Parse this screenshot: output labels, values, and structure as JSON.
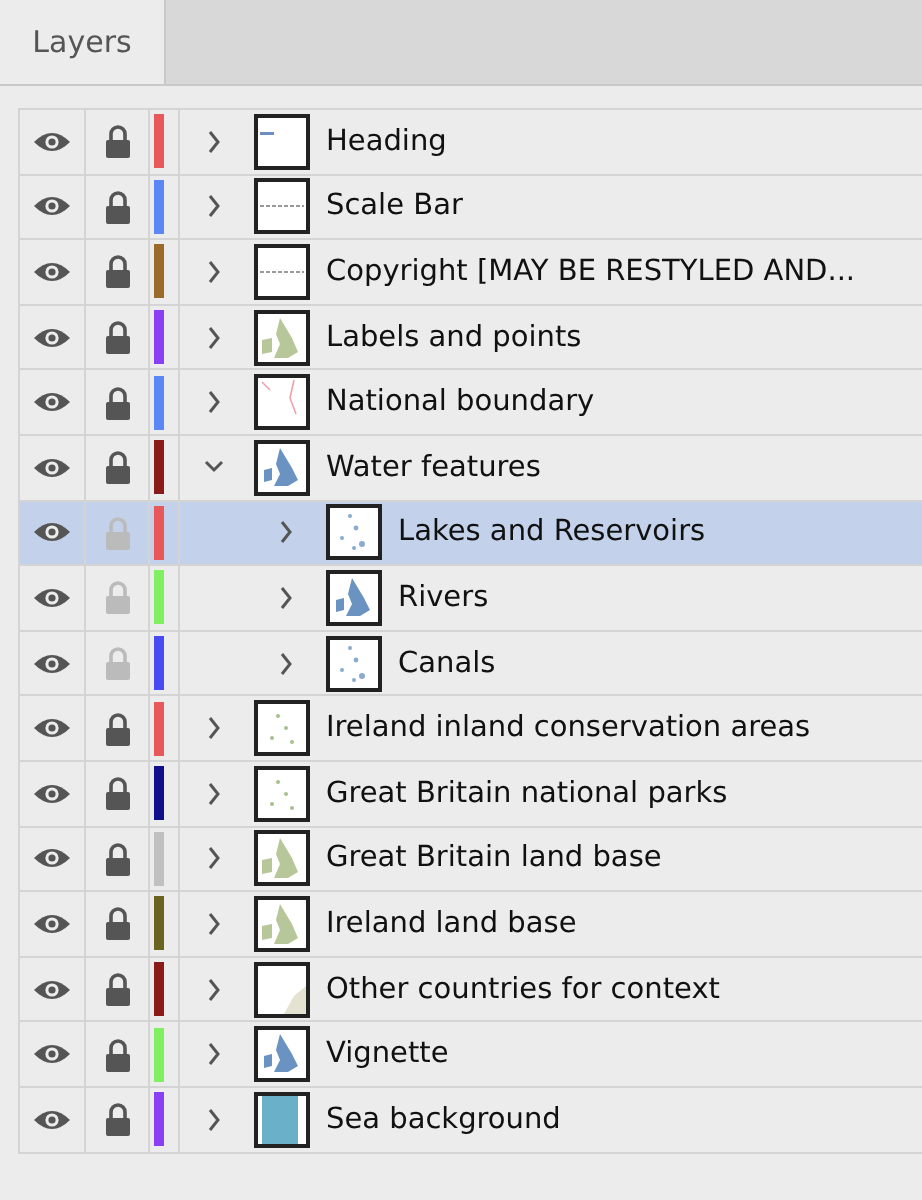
{
  "tab": {
    "label": "Layers",
    "selected": true
  },
  "layers": [
    {
      "name": "Heading",
      "color": "#e8585a",
      "visible": true,
      "locked": true,
      "expanded": false,
      "selected": false,
      "kind": "heading"
    },
    {
      "name": "Scale Bar",
      "color": "#5b86f5",
      "visible": true,
      "locked": true,
      "expanded": false,
      "selected": false,
      "kind": "scale"
    },
    {
      "name": "Copyright [MAY BE RESTYLED AND...",
      "color": "#9a6a2a",
      "visible": true,
      "locked": true,
      "expanded": false,
      "selected": false,
      "kind": "scale"
    },
    {
      "name": "Labels and points",
      "color": "#8a3ff5",
      "visible": true,
      "locked": true,
      "expanded": false,
      "selected": false,
      "kind": "land"
    },
    {
      "name": "National boundary",
      "color": "#5b86f5",
      "visible": true,
      "locked": true,
      "expanded": false,
      "selected": false,
      "kind": "lines"
    },
    {
      "name": "Water features",
      "color": "#8b1a1a",
      "visible": true,
      "locked": true,
      "expanded": true,
      "selected": false,
      "kind": "map",
      "children": [
        {
          "name": "Lakes and Reservoirs",
          "color": "#e8585a",
          "visible": true,
          "locked": false,
          "expanded": false,
          "selected": true,
          "kind": "speckle"
        },
        {
          "name": "Rivers",
          "color": "#80f060",
          "visible": true,
          "locked": false,
          "expanded": false,
          "selected": false,
          "kind": "map"
        },
        {
          "name": "Canals",
          "color": "#4a4af5",
          "visible": true,
          "locked": false,
          "expanded": false,
          "selected": false,
          "kind": "speckle"
        }
      ]
    },
    {
      "name": "Ireland inland conservation areas",
      "color": "#e8585a",
      "visible": true,
      "locked": true,
      "expanded": false,
      "selected": false,
      "kind": "speckle-green"
    },
    {
      "name": "Great Britain national parks",
      "color": "#10108a",
      "visible": true,
      "locked": true,
      "expanded": false,
      "selected": false,
      "kind": "speckle-green"
    },
    {
      "name": "Great Britain land base",
      "color": "#c0c0c0",
      "visible": true,
      "locked": true,
      "expanded": false,
      "selected": false,
      "kind": "land"
    },
    {
      "name": "Ireland land base",
      "color": "#6b6420",
      "visible": true,
      "locked": true,
      "expanded": false,
      "selected": false,
      "kind": "land"
    },
    {
      "name": "Other countries for context",
      "color": "#8b1a1a",
      "visible": true,
      "locked": true,
      "expanded": false,
      "selected": false,
      "kind": "corner"
    },
    {
      "name": "Vignette",
      "color": "#80f060",
      "visible": true,
      "locked": true,
      "expanded": false,
      "selected": false,
      "kind": "map"
    },
    {
      "name": "Sea background",
      "color": "#8a3ff5",
      "visible": true,
      "locked": true,
      "expanded": false,
      "selected": false,
      "kind": "sea"
    }
  ]
}
